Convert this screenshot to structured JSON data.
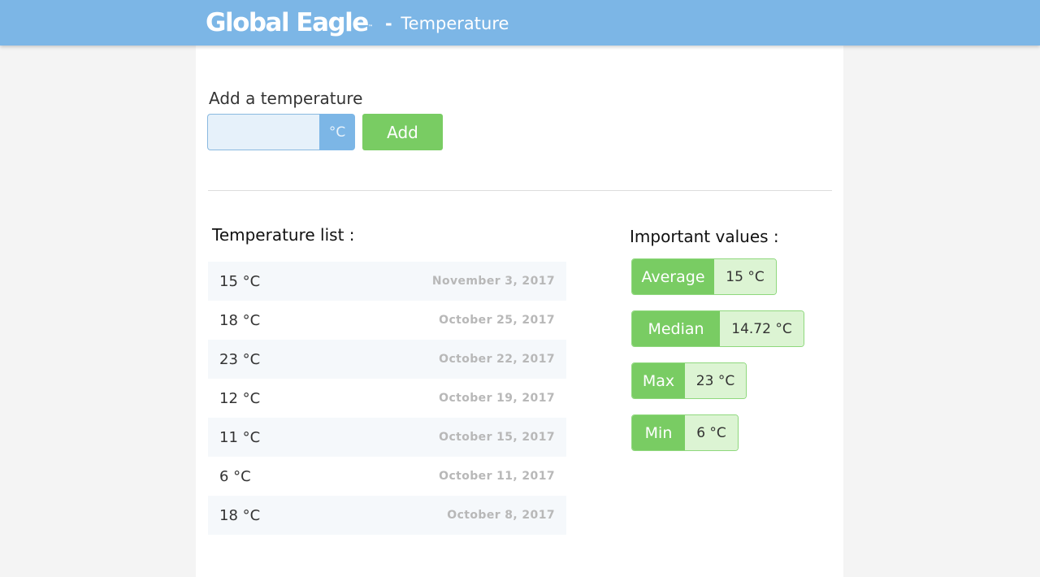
{
  "header": {
    "logo_text": "Global Eagle",
    "logo_tm": "™",
    "dash": "-",
    "title": "Temperature",
    "bar_color": "#7cb6e6"
  },
  "add_form": {
    "label": "Add a temperature",
    "input_value": "",
    "unit": "°C",
    "button_label": "Add",
    "button_color": "#79cc63"
  },
  "list": {
    "heading": "Temperature list :",
    "items": [
      {
        "value": "15 °C",
        "date": "November 3, 2017"
      },
      {
        "value": "18 °C",
        "date": "October 25, 2017"
      },
      {
        "value": "23 °C",
        "date": "October 22, 2017"
      },
      {
        "value": "12 °C",
        "date": "October 19, 2017"
      },
      {
        "value": "11 °C",
        "date": "October 15, 2017"
      },
      {
        "value": "6 °C",
        "date": "October 11, 2017"
      },
      {
        "value": "18 °C",
        "date": "October 8, 2017"
      }
    ]
  },
  "stats": {
    "heading": "Important values :",
    "average": {
      "label": "Average",
      "value": "15 °C"
    },
    "median": {
      "label": "Median",
      "value": "14.72 °C"
    },
    "max": {
      "label": "Max",
      "value": "23 °C"
    },
    "min": {
      "label": "Min",
      "value": "6 °C"
    }
  }
}
